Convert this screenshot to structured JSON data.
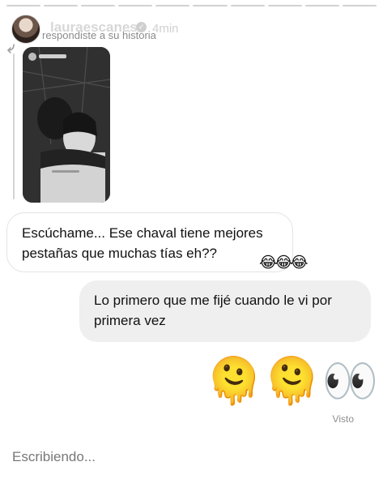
{
  "header": {
    "username": "lauraescanes",
    "time": "4min",
    "subtitle": "respondiste a su historia"
  },
  "messages": {
    "incoming": "Escúchame... Ese chaval tiene mejores pestañas que muchas tías eh??",
    "reaction": "😂😂😂",
    "outgoing": "Lo primero que me fijé cuando le vi por primera vez",
    "emoji": "🫠🫠👀",
    "seen": "Visto"
  },
  "composer": {
    "status": "Escribiendo..."
  },
  "progress": {
    "segments_total": 10,
    "segments_viewed": 10
  }
}
